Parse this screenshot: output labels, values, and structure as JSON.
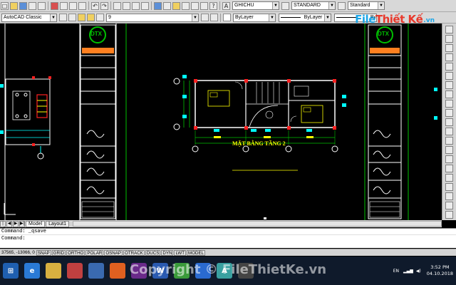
{
  "toolbar": {
    "workspace_combo": "AutoCAD Classic",
    "layer_combo": "9",
    "text_style_combo": "GHICHU",
    "dim_style_combo": "STANDARD",
    "table_style_combo": "Standard",
    "color_combo": "ByLayer",
    "linetype_combo": "ByLayer",
    "lineweight_combo": "By"
  },
  "logo": {
    "part1": "File",
    "part2": "Thiết Kế",
    "part3": ".vn"
  },
  "drawing": {
    "plan_title": "MẶT BẰNG TẦNG 2",
    "titleblock_logo": "DTX"
  },
  "layout_tabs": [
    "Model",
    "Layout1"
  ],
  "command": {
    "history_line": "Command:  _qsave",
    "prompt": "Command:"
  },
  "status": {
    "coords": "37565, -13066, 0",
    "toggles": [
      "SNAP",
      "GRID",
      "ORTHO",
      "POLAR",
      "OSNAP",
      "OTRACK",
      "DUCS",
      "DYN",
      "LWT",
      "MODEL"
    ]
  },
  "taskbar": {
    "language": "EN",
    "time": "3:52 PM",
    "date": "04.10.2018"
  },
  "watermark": "Copyright © FileThietKe.vn",
  "colors": {
    "background": "#000000",
    "cyan": "#00ffff",
    "green": "#00c000",
    "red": "#ff2020",
    "yellow": "#ffff00"
  }
}
